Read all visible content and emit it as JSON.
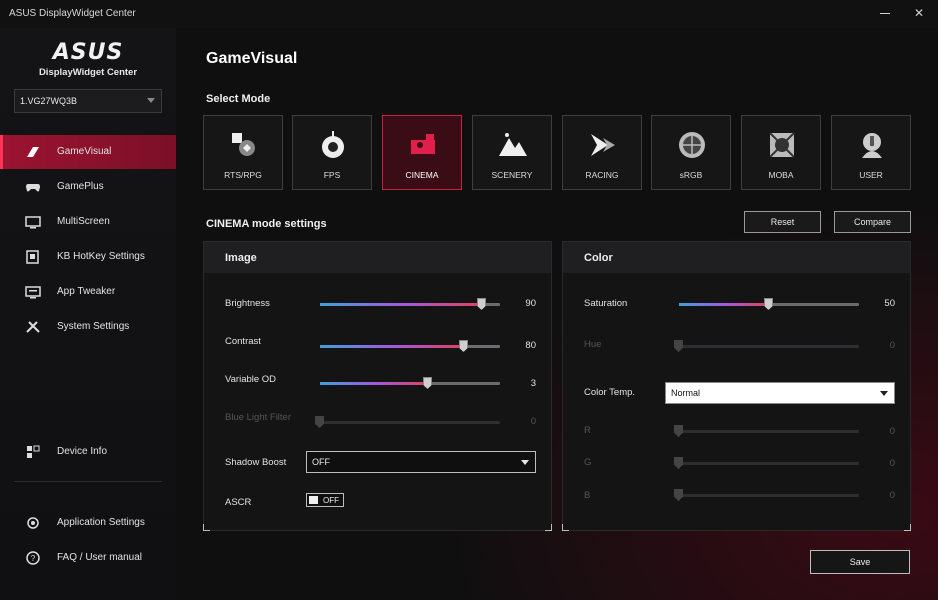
{
  "window": {
    "title": "ASUS DisplayWidget Center"
  },
  "logo": {
    "brand": "ASUS",
    "subtitle": "DisplayWidget Center"
  },
  "monitor_select": {
    "value": "1.VG27WQ3B"
  },
  "sidebar": {
    "items": [
      {
        "label": "GameVisual",
        "icon": "gamevisual-icon",
        "active": true
      },
      {
        "label": "GamePlus",
        "icon": "gamepad-icon"
      },
      {
        "label": "MultiScreen",
        "icon": "multiscreen-icon"
      },
      {
        "label": "KB HotKey Settings",
        "icon": "keyboard-icon"
      },
      {
        "label": "App Tweaker",
        "icon": "app-tweaker-icon"
      },
      {
        "label": "System Settings",
        "icon": "tools-icon"
      }
    ],
    "device_info": "Device Info",
    "app_settings": "Application Settings",
    "faq": "FAQ / User manual"
  },
  "main": {
    "title": "GameVisual",
    "select_mode_label": "Select Mode",
    "modes": [
      "RTS/RPG",
      "FPS",
      "CINEMA",
      "SCENERY",
      "RACING",
      "sRGB",
      "MOBA",
      "USER"
    ],
    "selected_mode": "CINEMA",
    "settings_title": "CINEMA mode settings",
    "reset_label": "Reset",
    "compare_label": "Compare",
    "save_label": "Save"
  },
  "image_panel": {
    "title": "Image",
    "brightness": {
      "label": "Brightness",
      "value": "90"
    },
    "contrast": {
      "label": "Contrast",
      "value": "80"
    },
    "variable_od": {
      "label": "Variable OD",
      "value": "3"
    },
    "blue_light": {
      "label": "Blue Light Filter",
      "value": "0"
    },
    "shadow_boost": {
      "label": "Shadow Boost",
      "value": "OFF"
    },
    "ascr": {
      "label": "ASCR",
      "value": "OFF"
    }
  },
  "color_panel": {
    "title": "Color",
    "saturation": {
      "label": "Saturation",
      "value": "50"
    },
    "hue": {
      "label": "Hue",
      "value": "0"
    },
    "color_temp": {
      "label": "Color Temp.",
      "value": "Normal"
    },
    "r": {
      "label": "R",
      "value": "0"
    },
    "g": {
      "label": "G",
      "value": "0"
    },
    "b": {
      "label": "B",
      "value": "0"
    }
  },
  "slider_levels": {
    "brightness": 0.9,
    "contrast": 0.8,
    "variable_od": 0.6,
    "blue_light": 0,
    "saturation": 0.5,
    "hue": 0,
    "r": 0,
    "g": 0,
    "b": 0
  },
  "colors": {
    "accent": "#9b1330",
    "accent_bright": "#c8203f"
  }
}
